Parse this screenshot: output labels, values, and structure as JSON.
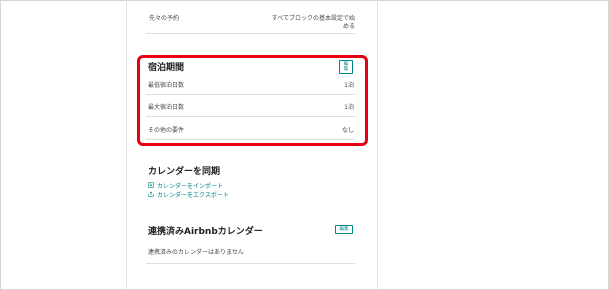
{
  "prior_notice": {
    "label": "先々の予約",
    "value_line1": "すべてブロックの基本設定で始",
    "value_line2": "める"
  },
  "stay_length": {
    "title": "宿泊期間",
    "edit_line1": "編",
    "edit_line2": "集",
    "rows": [
      {
        "label": "最低宿泊日数",
        "value": "1泊"
      },
      {
        "label": "最大宿泊日数",
        "value": "1泊"
      },
      {
        "label": "その他の要件",
        "value": "なし"
      }
    ]
  },
  "calendar_sync": {
    "title": "カレンダーを同期",
    "import_label": "カレンダーをインポート",
    "export_label": "カレンダーをエクスポート"
  },
  "airbnb_calendars": {
    "title": "連携済みAirbnbカレンダー",
    "edit_label": "編集",
    "empty_text": "連携済みのカレンダーはありません"
  },
  "colors": {
    "accent": "#008489",
    "highlight": "#e60012"
  }
}
